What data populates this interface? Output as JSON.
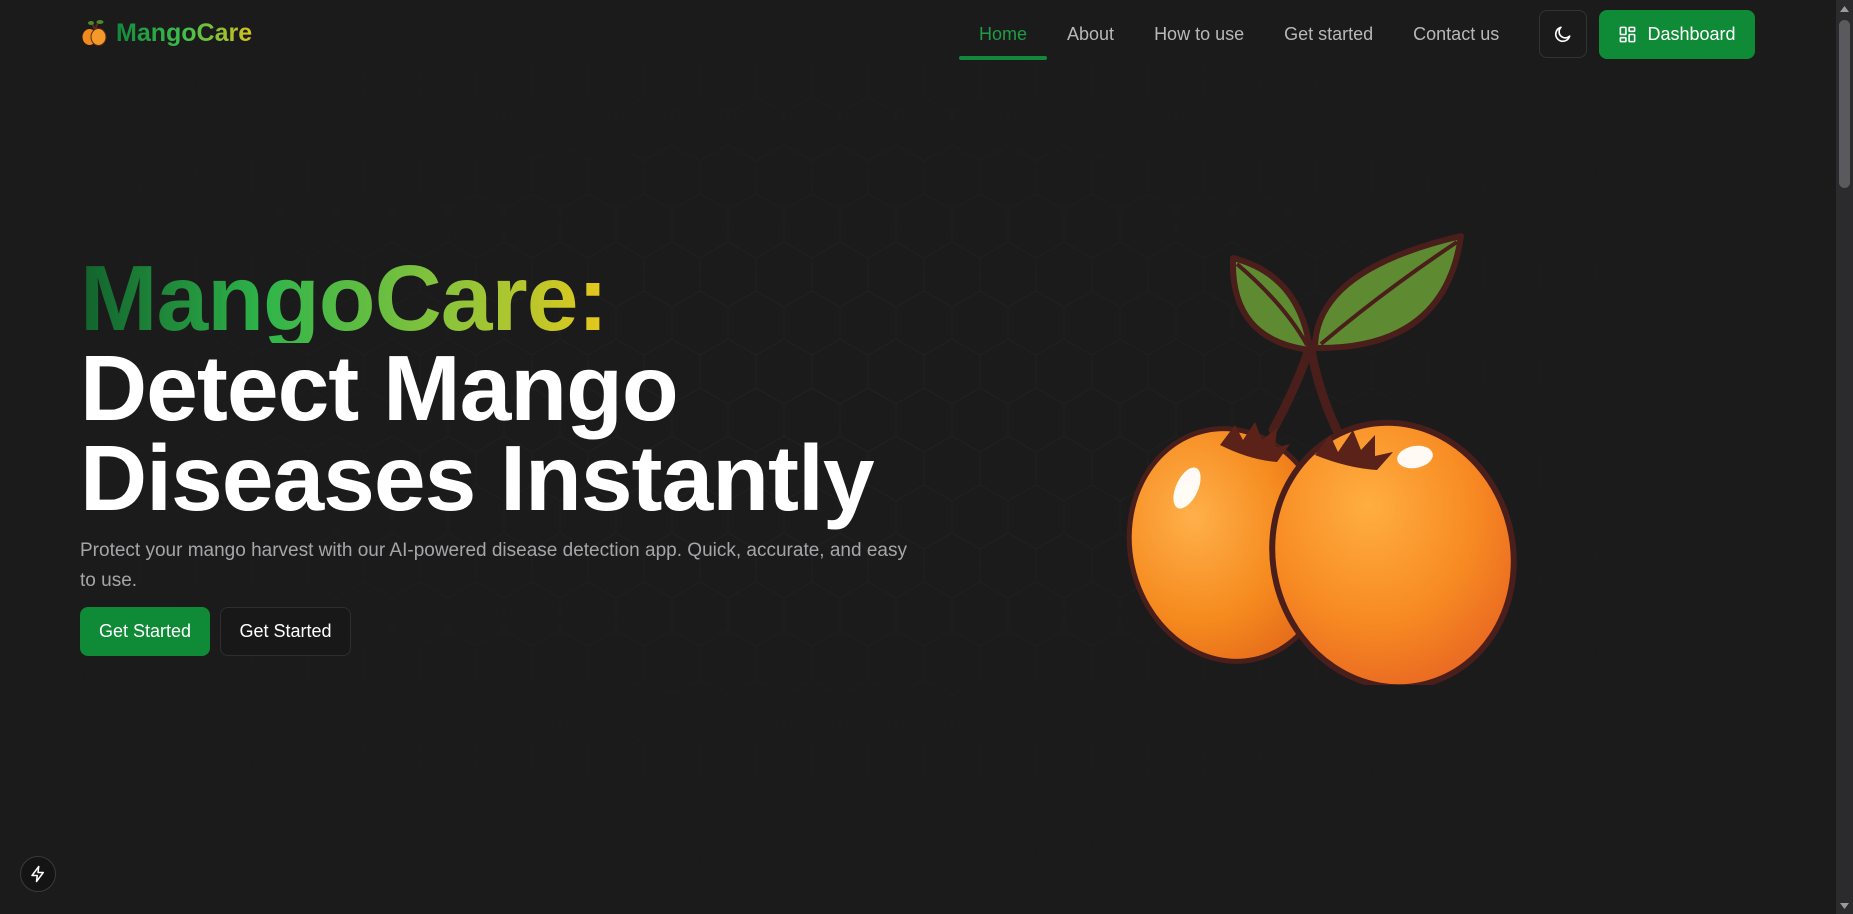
{
  "brand": {
    "logo_icon": "mango-logo-icon",
    "name": "MangoCare"
  },
  "nav": {
    "items": [
      {
        "label": "Home",
        "active": true
      },
      {
        "label": "About",
        "active": false
      },
      {
        "label": "How to use",
        "active": false
      },
      {
        "label": "Get started",
        "active": false
      },
      {
        "label": "Contact us",
        "active": false
      }
    ],
    "theme_toggle_icon": "moon-icon",
    "dashboard": {
      "label": "Dashboard",
      "icon": "dashboard-grid-icon"
    }
  },
  "hero": {
    "title_line1": "MangoCare:",
    "title_line2": "Detect Mango",
    "title_line3": "Diseases Instantly",
    "subtitle": "Protect your mango harvest with our AI-powered disease detection app. Quick, accurate, and easy to use.",
    "primary_button": "Get Started",
    "secondary_button": "Get Started",
    "illustration": "mango-illustration"
  },
  "floating_button": {
    "icon": "lightning-bolt-icon"
  },
  "colors": {
    "background": "#1b1b1c",
    "accent_green": "#0f8a37",
    "active_nav": "#1f9c44",
    "gradient_yellow": "#e8c91b",
    "text_muted": "#a6a6a8"
  }
}
